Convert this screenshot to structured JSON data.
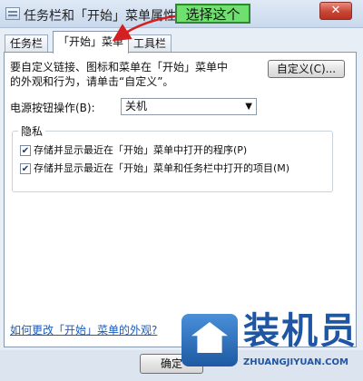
{
  "window": {
    "title": "任务栏和「开始」菜单属性",
    "close_label": "✕"
  },
  "tabs": [
    {
      "label": "任务栏",
      "active": false
    },
    {
      "label": "「开始」菜单",
      "active": true
    },
    {
      "label": "工具栏",
      "active": false
    }
  ],
  "annotation": {
    "callout": "选择这个"
  },
  "start_menu": {
    "description": "要自定义链接、图标和菜单在「开始」菜单中的外观和行为，请单击“自定义”。",
    "customize_button": "自定义(C)...",
    "power_label": "电源按钮操作(B):",
    "power_value": "关机",
    "privacy": {
      "title": "隐私",
      "options": [
        {
          "label": "存储并显示最近在「开始」菜单中打开的程序(P)",
          "checked": true
        },
        {
          "label": "存储并显示最近在「开始」菜单和任务栏中打开的项目(M)",
          "checked": true
        }
      ]
    },
    "appearance_link": "如何更改「开始」菜单的外观?"
  },
  "footer": {
    "ok_button": "确定"
  },
  "watermark": {
    "title": "装机员",
    "url": "ZHUANGJIYUAN.COM"
  }
}
